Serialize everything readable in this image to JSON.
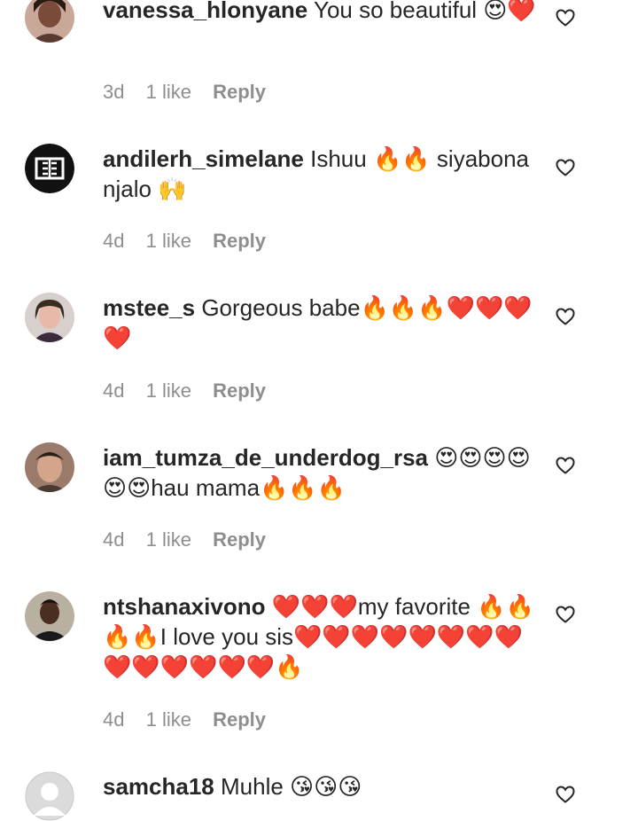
{
  "comments": [
    {
      "username": "vanessa_hlonyane",
      "text": "You so beautiful 😍❤️",
      "time": "3d",
      "likes": "1 like",
      "reply": "Reply",
      "avatar_icon": "profile-photo"
    },
    {
      "username": "andilerh_simelane",
      "text": "Ishuu 🔥🔥 siyabona njalo 🙌",
      "time": "4d",
      "likes": "1 like",
      "reply": "Reply",
      "avatar_icon": "logo-avatar"
    },
    {
      "username": "mstee_s",
      "text": "Gorgeous babe🔥🔥🔥❤️❤️❤️❤️",
      "time": "4d",
      "likes": "1 like",
      "reply": "Reply",
      "avatar_icon": "profile-photo"
    },
    {
      "username": "iam_tumza_de_underdog_rsa",
      "text": "😍😍😍😍😍😍hau mama🔥🔥🔥",
      "time": "4d",
      "likes": "1 like",
      "reply": "Reply",
      "avatar_icon": "profile-photo"
    },
    {
      "username": "ntshanaxivono",
      "text": "❤️❤️❤️my favorite 🔥🔥🔥🔥I love you sis❤️❤️❤️❤️❤️❤️❤️❤️❤️❤️❤️❤️❤️❤️🔥",
      "time": "4d",
      "likes": "1 like",
      "reply": "Reply",
      "avatar_icon": "profile-photo"
    },
    {
      "username": "samcha18",
      "text": "Muhle 😘😘😘",
      "time": "",
      "likes": "",
      "reply": "",
      "avatar_icon": "default-avatar"
    }
  ],
  "colors": {
    "text": "#262626",
    "meta": "#8e8e8e",
    "background": "#ffffff"
  }
}
